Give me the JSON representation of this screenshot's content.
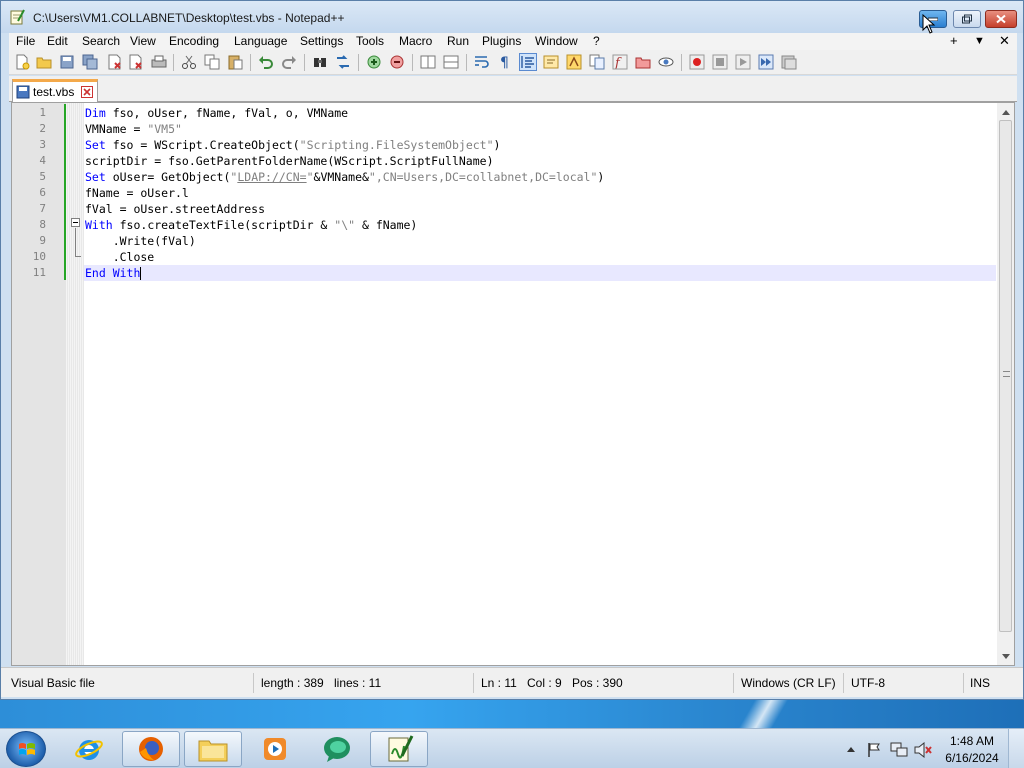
{
  "window": {
    "title": "C:\\Users\\VM1.COLLABNET\\Desktop\\test.vbs - Notepad++"
  },
  "menu": {
    "items": [
      "File",
      "Edit",
      "Search",
      "View",
      "Encoding",
      "Language",
      "Settings",
      "Tools",
      "Macro",
      "Run",
      "Plugins",
      "Window",
      "?"
    ],
    "right": [
      "+",
      "▼",
      "✕"
    ]
  },
  "toolbar": {
    "icons": [
      "new-file-icon",
      "open-file-icon",
      "save-icon",
      "save-all-icon",
      "close-icon",
      "close-all-icon",
      "print-icon",
      "cut-icon",
      "copy-icon",
      "paste-icon",
      "undo-icon",
      "redo-icon",
      "find-icon",
      "replace-icon",
      "zoom-in-icon",
      "zoom-out-icon",
      "sync-vertical-icon",
      "sync-horizontal-icon",
      "word-wrap-icon",
      "show-all-chars-icon",
      "indent-guide-icon",
      "user-language-icon",
      "document-map-icon",
      "function-list-icon",
      "folder-workspace-icon",
      "monitoring-icon",
      "record-macro-icon",
      "stop-macro-icon",
      "play-macro-icon",
      "run-macro-multiple-icon",
      "save-macro-icon"
    ]
  },
  "tabs": [
    {
      "label": "test.vbs",
      "active": true
    }
  ],
  "editor": {
    "language": "Visual Basic",
    "lines": [
      {
        "num": "1",
        "parts": [
          [
            "kw",
            "Dim"
          ],
          [
            "",
            " fso, oUser, fName, fVal, o, VMName"
          ]
        ]
      },
      {
        "num": "2",
        "parts": [
          [
            "",
            "VMName = "
          ],
          [
            "str",
            "\"VM5\""
          ]
        ]
      },
      {
        "num": "3",
        "parts": [
          [
            "kw",
            "Set"
          ],
          [
            "",
            " fso = WScript.CreateObject("
          ],
          [
            "str",
            "\"Scripting.FileSystemObject\""
          ],
          [
            "",
            ")"
          ]
        ]
      },
      {
        "num": "4",
        "parts": [
          [
            "",
            "scriptDir = fso.GetParentFolderName(WScript.ScriptFullName)"
          ]
        ]
      },
      {
        "num": "5",
        "parts": [
          [
            "kw",
            "Set"
          ],
          [
            "",
            " oUser= GetObject("
          ],
          [
            "str",
            "\""
          ],
          [
            "str ul",
            "LDAP://CN="
          ],
          [
            "str",
            "\""
          ],
          [
            "",
            "&VMName&"
          ],
          [
            "str",
            "\",CN=Users,DC=collabnet,DC=local\""
          ],
          [
            "",
            ")"
          ]
        ]
      },
      {
        "num": "6",
        "parts": [
          [
            "",
            "fName = oUser.l"
          ]
        ]
      },
      {
        "num": "7",
        "parts": [
          [
            "",
            "fVal = oUser.streetAddress"
          ]
        ]
      },
      {
        "num": "8",
        "parts": [
          [
            "kw",
            "With"
          ],
          [
            "",
            " fso.createTextFile(scriptDir & "
          ],
          [
            "str",
            "\"\\\""
          ],
          [
            "",
            " & fName)"
          ]
        ]
      },
      {
        "num": "9",
        "parts": [
          [
            "",
            "    .Write(fVal)"
          ]
        ]
      },
      {
        "num": "10",
        "parts": [
          [
            "",
            "    .Close"
          ]
        ]
      },
      {
        "num": "11",
        "parts": [
          [
            "kw",
            "End With"
          ]
        ],
        "current": true
      }
    ]
  },
  "status": {
    "file_type": "Visual Basic file",
    "length": "length : 389",
    "lines": "lines : 11",
    "ln": "Ln : 11",
    "col": "Col : 9",
    "pos": "Pos : 390",
    "eol": "Windows (CR LF)",
    "encoding": "UTF-8",
    "mode": "INS"
  },
  "taskbar": {
    "apps": [
      "internet-explorer-icon",
      "firefox-icon",
      "file-explorer-icon",
      "media-player-icon",
      "teams-icon",
      "notepadpp-icon"
    ],
    "active_app": "notepadpp-icon",
    "tray_icons": [
      "show-hidden-icons-icon",
      "action-center-flag-icon",
      "network-icon",
      "volume-muted-icon"
    ],
    "time": "1:48 AM",
    "date": "6/16/2024"
  },
  "colors": {
    "keyword": "#0000ff",
    "string": "#808080",
    "current_line": "#e8e8ff",
    "tab_accent": "#f4a94a",
    "change_bar": "#26a626"
  }
}
